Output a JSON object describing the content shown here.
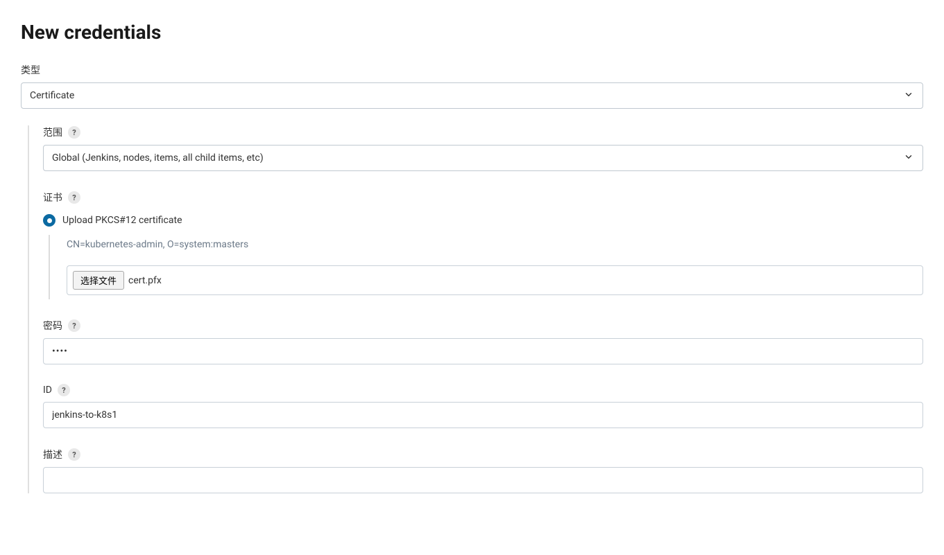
{
  "page": {
    "title": "New credentials"
  },
  "labels": {
    "type": "类型",
    "scope": "范围",
    "certificate": "证书",
    "password": "密码",
    "id": "ID",
    "description": "描述"
  },
  "type": {
    "value": "Certificate"
  },
  "scope": {
    "value": "Global (Jenkins, nodes, items, all child items, etc)"
  },
  "cert": {
    "radio_label": "Upload PKCS#12 certificate",
    "info": "CN=kubernetes-admin, O=system:masters",
    "file_button": "选择文件",
    "file_name": "cert.pfx"
  },
  "password": {
    "value": "••••"
  },
  "id": {
    "value": "jenkins-to-k8s1"
  },
  "description": {
    "value": ""
  },
  "help": {
    "symbol": "?"
  }
}
